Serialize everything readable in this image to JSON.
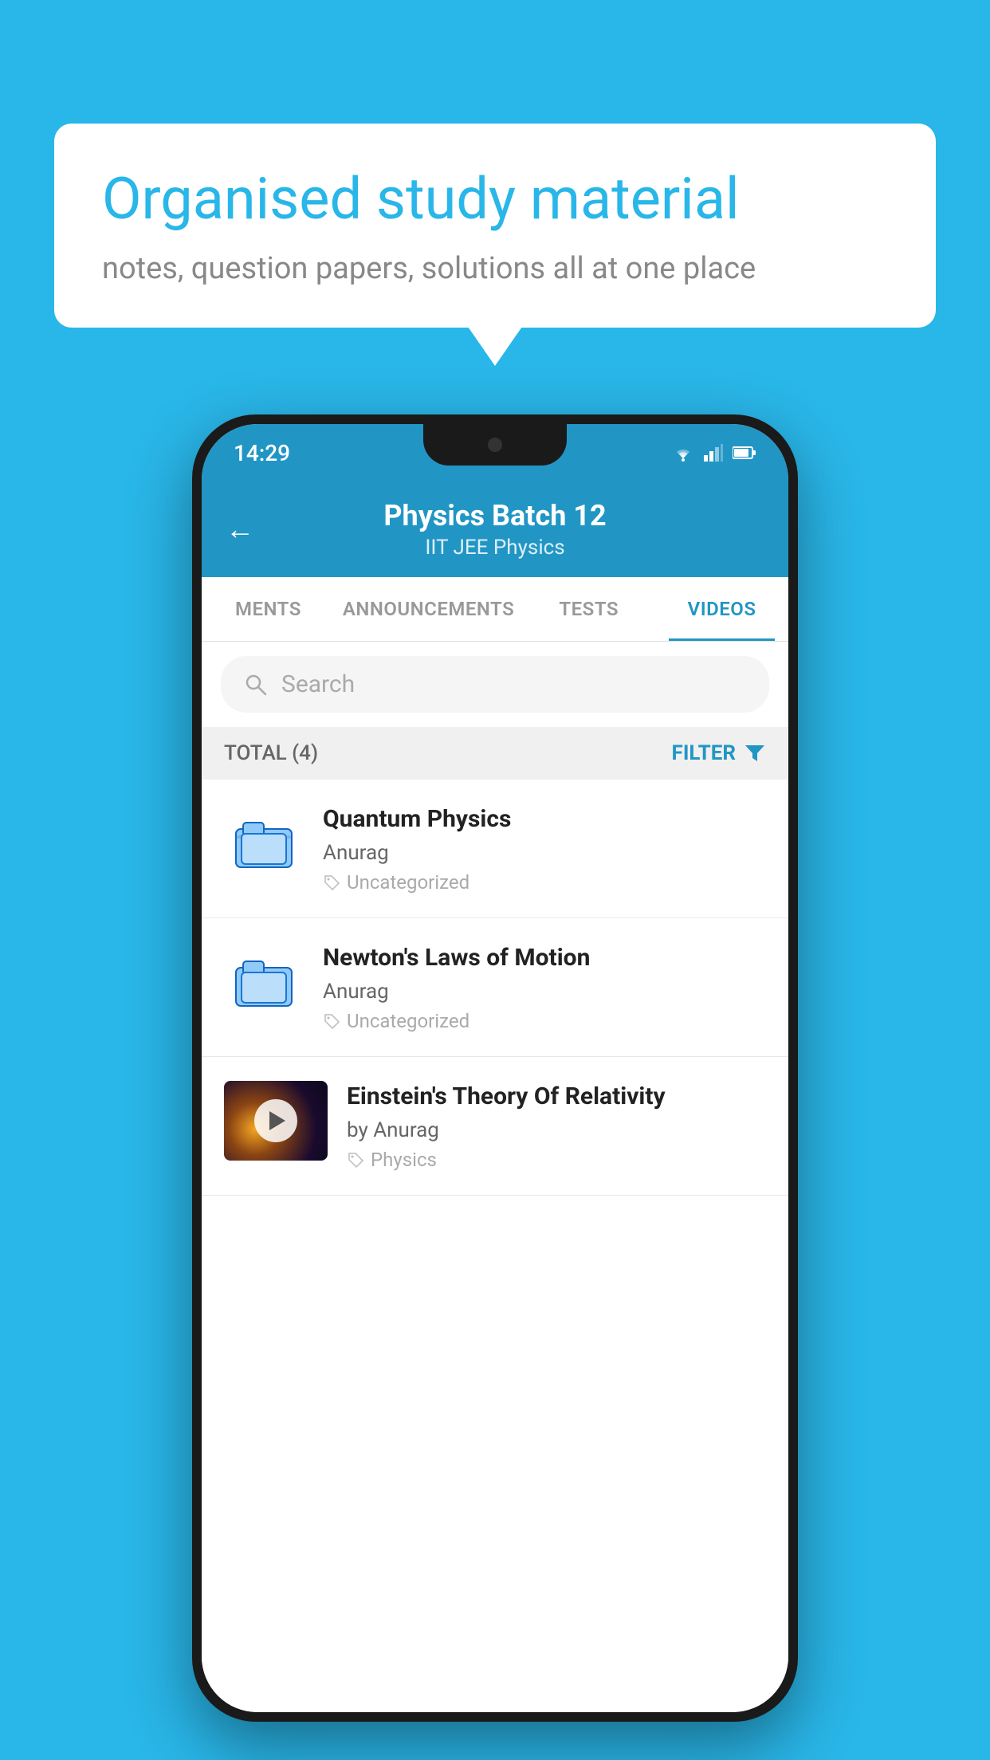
{
  "background": {
    "color": "#29B6E8"
  },
  "speech_bubble": {
    "title": "Organised study material",
    "subtitle": "notes, question papers, solutions all at one place"
  },
  "phone": {
    "status_bar": {
      "time": "14:29",
      "wifi": "▼",
      "signal": "▲",
      "battery": "▌"
    },
    "header": {
      "back_label": "←",
      "title": "Physics Batch 12",
      "subtitle": "IIT JEE    Physics"
    },
    "tabs": [
      {
        "label": "MENTS",
        "active": false
      },
      {
        "label": "ANNOUNCEMENTS",
        "active": false
      },
      {
        "label": "TESTS",
        "active": false
      },
      {
        "label": "VIDEOS",
        "active": true
      }
    ],
    "search": {
      "placeholder": "Search"
    },
    "filter_bar": {
      "total_label": "TOTAL (4)",
      "filter_label": "FILTER"
    },
    "videos": [
      {
        "id": 1,
        "title": "Quantum Physics",
        "author": "Anurag",
        "tag": "Uncategorized",
        "has_thumbnail": false
      },
      {
        "id": 2,
        "title": "Newton's Laws of Motion",
        "author": "Anurag",
        "tag": "Uncategorized",
        "has_thumbnail": false
      },
      {
        "id": 3,
        "title": "Einstein's Theory Of Relativity",
        "author": "by Anurag",
        "tag": "Physics",
        "has_thumbnail": true
      }
    ]
  }
}
